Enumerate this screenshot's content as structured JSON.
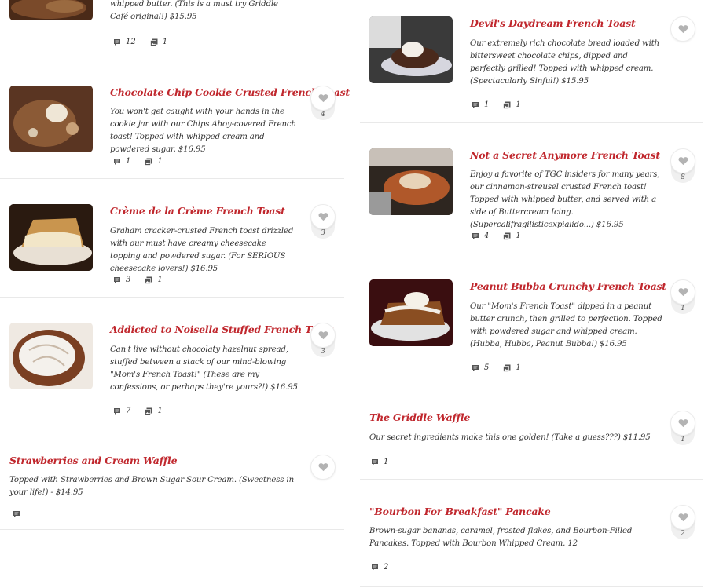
{
  "left_column": [
    {
      "title": "",
      "description": "whipped butter.  (This is a must try Griddle Café original!) $15.95",
      "comments": "12",
      "photos": "1",
      "likes": ""
    },
    {
      "title": "Chocolate Chip Cookie Crusted French Toast",
      "description": "You won't get caught with your hands in the cookie jar with our Chips Ahoy-covered French toast! Topped with whipped cream and powdered sugar. $16.95",
      "comments": "1",
      "photos": "1",
      "likes": "4"
    },
    {
      "title": "Crème de la Crème French Toast",
      "description": "Graham cracker-crusted French toast drizzled with our must have creamy cheesecake topping and powdered sugar.  (For SERIOUS cheesecake lovers!) $16.95",
      "comments": "3",
      "photos": "1",
      "likes": "3"
    },
    {
      "title": "Addicted to Noisella Stuffed French Toast",
      "description": "Can't live without chocolaty hazelnut spread, stuffed between a stack of our mind-blowing \"Mom's French Toast!\" (These are my confessions, or perhaps they're yours?!) $16.95",
      "comments": "7",
      "photos": "1",
      "likes": "3"
    },
    {
      "title": "Strawberries and Cream Waffle",
      "description": "Topped with Strawberries and Brown Sugar Sour Cream.  (Sweetness in your life!) - $14.95",
      "comments": "",
      "photos": "",
      "likes": ""
    }
  ],
  "right_column": [
    {
      "title": "Devil's Daydream French Toast",
      "description": "Our extremely rich chocolate bread loaded with bittersweet chocolate chips, dipped and perfectly grilled! Topped with whipped cream.  (Spectacularly Sinful!) $15.95",
      "comments": "1",
      "photos": "1",
      "likes": ""
    },
    {
      "title": "Not a Secret Anymore French Toast",
      "description": "Enjoy a favorite of TGC insiders for many years, our cinnamon-streusel crusted French toast! Topped with whipped butter, and served with a side of Buttercream Icing.  (Supercalifragilisticexpialido...) $16.95",
      "comments": "4",
      "photos": "1",
      "likes": "8"
    },
    {
      "title": "Peanut Bubba Crunchy French Toast",
      "description": "Our \"Mom's French Toast\" dipped in a peanut butter crunch, then grilled to perfection. Topped with powdered sugar and whipped cream.  (Hubba, Hubba, Peanut Bubba!) $16.95",
      "comments": "5",
      "photos": "1",
      "likes": "1"
    },
    {
      "title": "The Griddle Waffle",
      "description": "Our secret ingredients make this one golden!  (Take a guess???) $11.95",
      "comments": "1",
      "photos": "",
      "likes": "1"
    },
    {
      "title": "\"Bourbon For Breakfast\" Pancake",
      "description": "Brown-sugar bananas, caramel, frosted flakes, and Bourbon-Filled Pancakes. Topped with Bourbon Whipped Cream. 12",
      "comments": "2",
      "photos": "",
      "likes": "2"
    }
  ],
  "colors": {
    "title": "#c0272d",
    "text": "#333333",
    "divider": "#e9e9e9",
    "heart": "#b3b3b3"
  },
  "icons": {
    "comment": "comment-icon",
    "photo": "photo-icon",
    "like": "heart-icon"
  }
}
